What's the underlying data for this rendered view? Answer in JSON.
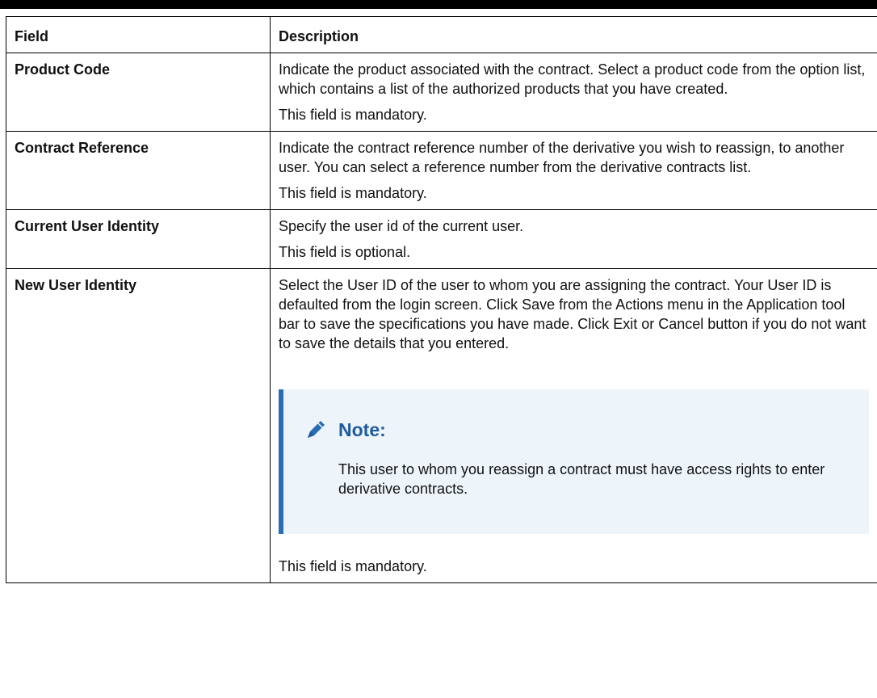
{
  "table": {
    "headers": {
      "field": "Field",
      "description": "Description"
    },
    "rows": [
      {
        "field": "Product Code",
        "description": "Indicate the product associated with the contract. Select a product code from the option list, which contains a list of the authorized products that you have created.",
        "note": "This field is mandatory."
      },
      {
        "field": "Contract Reference",
        "description": "Indicate the contract reference number of the derivative you wish to reassign, to another user. You can select a reference number from the derivative contracts list.",
        "note": "This field is mandatory."
      },
      {
        "field": "Current User Identity",
        "description": "Specify the user id of the current user.",
        "note": "This field is optional."
      },
      {
        "field": "New User Identity",
        "description": "Select the User ID of the user to whom you are assigning the contract. Your User ID is defaulted from the login screen. Click Save from the Actions menu in the Application tool bar to save the specifications you have made. Click Exit or Cancel button if you do not want to save the details that you entered.",
        "callout": {
          "icon": "pencil-icon",
          "title": "Note:",
          "text": "This user to whom you reassign a contract must have access rights to enter derivative contracts."
        },
        "note": "This field is mandatory."
      }
    ]
  },
  "colors": {
    "callout_background": "#eef5fa",
    "callout_accent": "#2a6db0",
    "callout_title": "#1f5aa0"
  }
}
